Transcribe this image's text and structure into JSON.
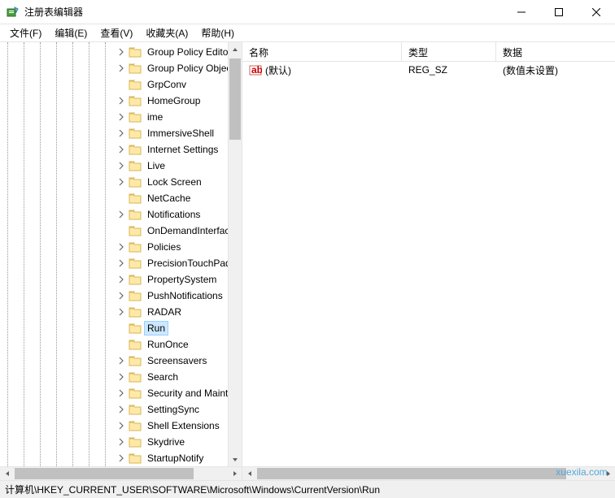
{
  "window": {
    "title": "注册表编辑器"
  },
  "menu": {
    "file": "文件(F)",
    "edit": "编辑(E)",
    "view": "查看(V)",
    "favorites": "收藏夹(A)",
    "help": "帮助(H)"
  },
  "tree": {
    "items": [
      {
        "label": "Group Policy Editor",
        "expandable": true
      },
      {
        "label": "Group Policy Objec",
        "expandable": true
      },
      {
        "label": "GrpConv",
        "expandable": false
      },
      {
        "label": "HomeGroup",
        "expandable": true
      },
      {
        "label": "ime",
        "expandable": true
      },
      {
        "label": "ImmersiveShell",
        "expandable": true
      },
      {
        "label": "Internet Settings",
        "expandable": true
      },
      {
        "label": "Live",
        "expandable": true
      },
      {
        "label": "Lock Screen",
        "expandable": true
      },
      {
        "label": "NetCache",
        "expandable": false
      },
      {
        "label": "Notifications",
        "expandable": true
      },
      {
        "label": "OnDemandInterface",
        "expandable": false
      },
      {
        "label": "Policies",
        "expandable": true
      },
      {
        "label": "PrecisionTouchPad",
        "expandable": true
      },
      {
        "label": "PropertySystem",
        "expandable": true
      },
      {
        "label": "PushNotifications",
        "expandable": true
      },
      {
        "label": "RADAR",
        "expandable": true
      },
      {
        "label": "Run",
        "expandable": false,
        "selected": true
      },
      {
        "label": "RunOnce",
        "expandable": false
      },
      {
        "label": "Screensavers",
        "expandable": true
      },
      {
        "label": "Search",
        "expandable": true
      },
      {
        "label": "Security and Mainte",
        "expandable": true
      },
      {
        "label": "SettingSync",
        "expandable": true
      },
      {
        "label": "Shell Extensions",
        "expandable": true
      },
      {
        "label": "Skydrive",
        "expandable": true
      },
      {
        "label": "StartupNotify",
        "expandable": true
      }
    ]
  },
  "list": {
    "columns": {
      "name": "名称",
      "type": "类型",
      "data": "数据"
    },
    "rows": [
      {
        "name": "(默认)",
        "type": "REG_SZ",
        "data": "(数值未设置)"
      }
    ]
  },
  "statusbar": {
    "path": "计算机\\HKEY_CURRENT_USER\\SOFTWARE\\Microsoft\\Windows\\CurrentVersion\\Run"
  },
  "watermark": {
    "a": "xuexila",
    "b": ".",
    "c": "com",
    "d": "."
  }
}
